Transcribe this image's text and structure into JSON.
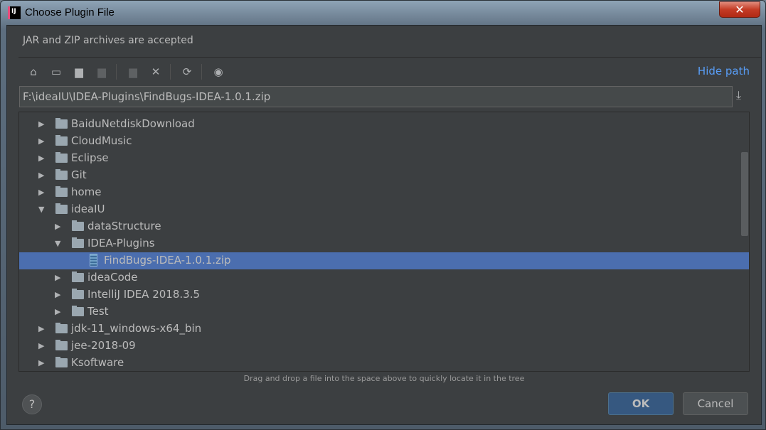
{
  "window": {
    "title": "Choose Plugin File",
    "close": "✕"
  },
  "dialog": {
    "description": "JAR and ZIP archives are accepted",
    "hide_path": "Hide path",
    "path_value": "F:\\ideaIU\\IDEA-Plugins\\FindBugs-IDEA-1.0.1.zip",
    "toolbar": [
      "home-icon",
      "desktop-icon",
      "project-folder-icon",
      "module-folder-icon",
      "new-folder-icon",
      "delete-icon",
      "refresh-icon",
      "show-hidden-icon"
    ],
    "tree": [
      {
        "label": "BaiduNetdiskDownload",
        "level": 1,
        "type": "folder",
        "expanded": false
      },
      {
        "label": "CloudMusic",
        "level": 1,
        "type": "folder",
        "expanded": false
      },
      {
        "label": "Eclipse",
        "level": 1,
        "type": "folder",
        "expanded": false
      },
      {
        "label": "Git",
        "level": 1,
        "type": "folder",
        "expanded": false
      },
      {
        "label": "home",
        "level": 1,
        "type": "folder",
        "expanded": false
      },
      {
        "label": "ideaIU",
        "level": 1,
        "type": "folder",
        "expanded": true
      },
      {
        "label": "dataStructure",
        "level": 2,
        "type": "folder",
        "expanded": false
      },
      {
        "label": "IDEA-Plugins",
        "level": 2,
        "type": "folder",
        "expanded": true
      },
      {
        "label": "FindBugs-IDEA-1.0.1.zip",
        "level": 3,
        "type": "zip",
        "selected": true
      },
      {
        "label": "ideaCode",
        "level": 2,
        "type": "folder",
        "expanded": false
      },
      {
        "label": "IntelliJ IDEA 2018.3.5",
        "level": 2,
        "type": "folder",
        "expanded": false
      },
      {
        "label": "Test",
        "level": 2,
        "type": "folder",
        "expanded": false
      },
      {
        "label": "jdk-11_windows-x64_bin",
        "level": 1,
        "type": "folder",
        "expanded": false
      },
      {
        "label": "jee-2018-09",
        "level": 1,
        "type": "folder",
        "expanded": false
      },
      {
        "label": "Ksoftware",
        "level": 1,
        "type": "folder",
        "expanded": false
      }
    ],
    "hint": "Drag and drop a file into the space above to quickly locate it in the tree",
    "help": "?",
    "ok": "OK",
    "cancel": "Cancel"
  },
  "colors": {
    "background": "#3c3f41",
    "selection": "#4b6eaf",
    "link": "#589df6",
    "ok_button": "#365880"
  }
}
